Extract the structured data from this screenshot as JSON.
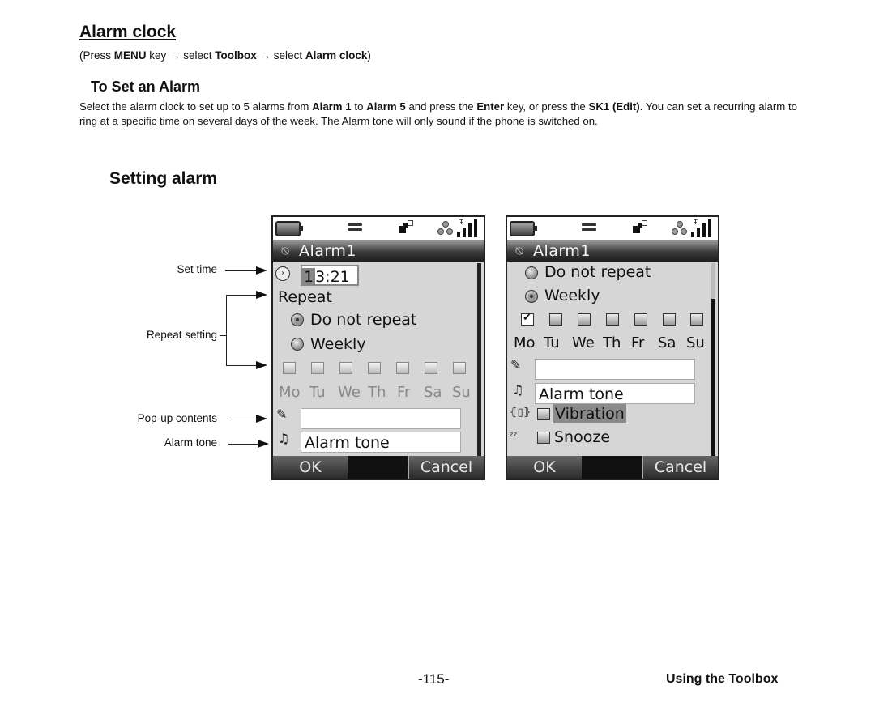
{
  "page": {
    "title": "Alarm clock",
    "nav_path": {
      "prefix": "(Press ",
      "key": "MENU",
      "key_suffix": " key → select ",
      "menu": "Toolbox",
      "sep": "  → select ",
      "item": "Alarm clock",
      "suffix": ")"
    },
    "section_heading": "To Set an Alarm",
    "paragraph": {
      "t1": "Select the alarm clock to set up to 5 alarms from ",
      "b1": "Alarm 1",
      "t2": " to ",
      "b2": "Alarm 5",
      "t3": " and press the ",
      "b3": "Enter",
      "t4": " key, or press the ",
      "b4": "SK1 (Edit)",
      "t5": ". You can set a recurring alarm to ring at a specific time on several days of the week. The Alarm tone will only sound if the phone is switched on."
    },
    "figure_heading": "Setting alarm",
    "footer": {
      "page_number": "-115-",
      "section": "Using the Toolbox"
    }
  },
  "annotations": {
    "set_time": "Set time",
    "repeat_setting": "Repeat setting",
    "popup_contents": "Pop-up contents",
    "alarm_tone": "Alarm tone"
  },
  "screen1": {
    "title": "Alarm1",
    "time_value": "13:21",
    "time_cursor_digit": "1",
    "time_rest": "3:21",
    "repeat_label": "Repeat",
    "options": [
      {
        "label": "Do not repeat",
        "selected": true
      },
      {
        "label": "Weekly",
        "selected": false
      }
    ],
    "days": [
      "Mo",
      "Tu",
      "We",
      "Th",
      "Fr",
      "Sa",
      "Su"
    ],
    "days_checked": [
      false,
      false,
      false,
      false,
      false,
      false,
      false
    ],
    "popup_value": "",
    "alarm_tone": "Alarm tone",
    "softkeys": {
      "left": "OK",
      "right": "Cancel"
    }
  },
  "screen2": {
    "title": "Alarm1",
    "options": [
      {
        "label": "Do not repeat",
        "selected": false
      },
      {
        "label": "Weekly",
        "selected": true
      }
    ],
    "days": [
      "Mo",
      "Tu",
      "We",
      "Th",
      "Fr",
      "Sa",
      "Su"
    ],
    "days_checked": [
      true,
      false,
      false,
      false,
      false,
      false,
      false
    ],
    "popup_value": "",
    "alarm_tone": "Alarm tone",
    "vibration": {
      "label": "Vibration",
      "checked": false
    },
    "snooze": {
      "label": "Snooze",
      "checked": false
    },
    "softkeys": {
      "left": "OK",
      "right": "Cancel"
    }
  },
  "icons": {
    "battery": "battery-icon",
    "equalizer": "line-icon",
    "data": "data-icon",
    "dots": "bluetooth-dots-icon",
    "signal": "signal-icon",
    "alarm_off": "alarm-bell-crossed-icon",
    "clock": "clock-icon",
    "pencil": "pencil-icon",
    "music_note": "music-note-icon",
    "vibration": "vibration-icon",
    "snooze": "snooze-icon"
  }
}
